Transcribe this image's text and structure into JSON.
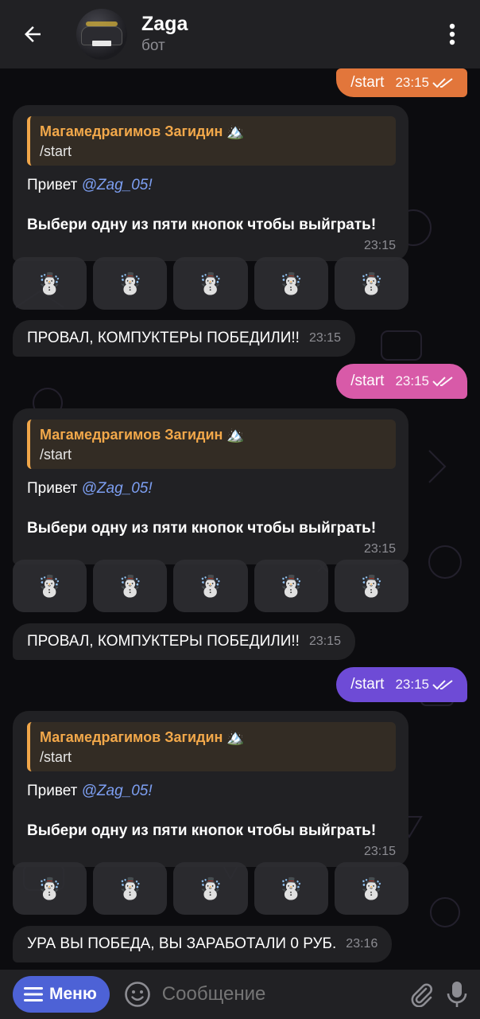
{
  "header": {
    "title": "Zaga",
    "subtitle": "бот"
  },
  "chat": {
    "outgoing": [
      {
        "text": "/start",
        "time": "23:15",
        "color": "#e2763b"
      },
      {
        "text": "/start",
        "time": "23:15",
        "color": "#d85aa8"
      },
      {
        "text": "/start",
        "time": "23:15",
        "color": "#6e4bd6"
      }
    ],
    "incoming": [
      {
        "reply_name": "Магамедрагимов Загидин 🏔️",
        "reply_text": "/start",
        "greeting_prefix": "Привет ",
        "mention": "@Zag_05",
        "greeting_suffix": "!",
        "body": "Выбери одну из пяти кнопок чтобы выйграть!",
        "time": "23:15"
      },
      {
        "reply_name": "Магамедрагимов Загидин 🏔️",
        "reply_text": "/start",
        "greeting_prefix": "Привет ",
        "mention": "@Zag_05",
        "greeting_suffix": "!",
        "body": "Выбери одну из пяти кнопок чтобы выйграть!",
        "time": "23:15"
      },
      {
        "reply_name": "Магамедрагимов Загидин 🏔️",
        "reply_text": "/start",
        "greeting_prefix": "Привет ",
        "mention": "@Zag_05",
        "greeting_suffix": "!",
        "body": "Выбери одну из пяти кнопок чтобы выйграть!",
        "time": "23:15"
      }
    ],
    "keyboard_button": "☃️",
    "results": [
      {
        "text": "ПРОВАЛ, КОМПУКТЕРЫ ПОБЕДИЛИ!!",
        "time": "23:15"
      },
      {
        "text": "ПРОВАЛ, КОМПУКТЕРЫ ПОБЕДИЛИ!!",
        "time": "23:15"
      },
      {
        "text": "УРА ВЫ ПОБЕДА, ВЫ ЗАРАБОТАЛИ 0 РУБ.",
        "time": "23:16"
      }
    ]
  },
  "bottom": {
    "menu_label": "Меню",
    "input_placeholder": "Сообщение"
  },
  "colors": {
    "accent_reply": "#f2a84a",
    "mention": "#7d9ff2",
    "menu_button": "#4d62d6"
  },
  "icons": [
    "back-arrow-icon",
    "more-vertical-icon",
    "read-check-icon",
    "snowman-icon",
    "menu-lines-icon",
    "emoji-icon",
    "paperclip-icon",
    "microphone-icon"
  ]
}
